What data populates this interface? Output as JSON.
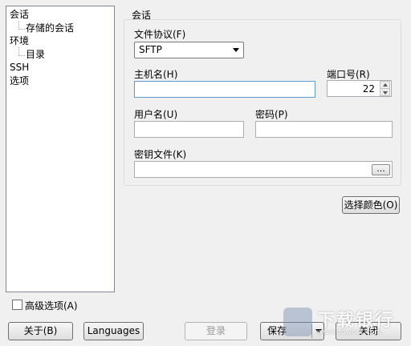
{
  "tree": {
    "items": [
      {
        "label": "会话"
      },
      {
        "label": "存储的会话"
      },
      {
        "label": "环境"
      },
      {
        "label": "目录"
      },
      {
        "label": "SSH"
      },
      {
        "label": "选项"
      }
    ]
  },
  "session": {
    "group_title": "会话",
    "protocol_label": "文件协议(F)",
    "protocol_value": "SFTP",
    "host_label": "主机名(H)",
    "host_value": "",
    "port_label": "端口号(R)",
    "port_value": "22",
    "user_label": "用户名(U)",
    "user_value": "",
    "password_label": "密码(P)",
    "password_value": "",
    "keyfile_label": "密钥文件(K)",
    "keyfile_value": "",
    "browse_label": "..."
  },
  "color_button_label": "选择颜色(O)",
  "advanced_label": "高级选项(A)",
  "buttons": {
    "about": "关于(B)",
    "languages": "Languages",
    "login": "登录",
    "save": "保存",
    "close": "关闭"
  },
  "watermark": {
    "text": "下载银行",
    "sub": "www.downcc.com"
  }
}
